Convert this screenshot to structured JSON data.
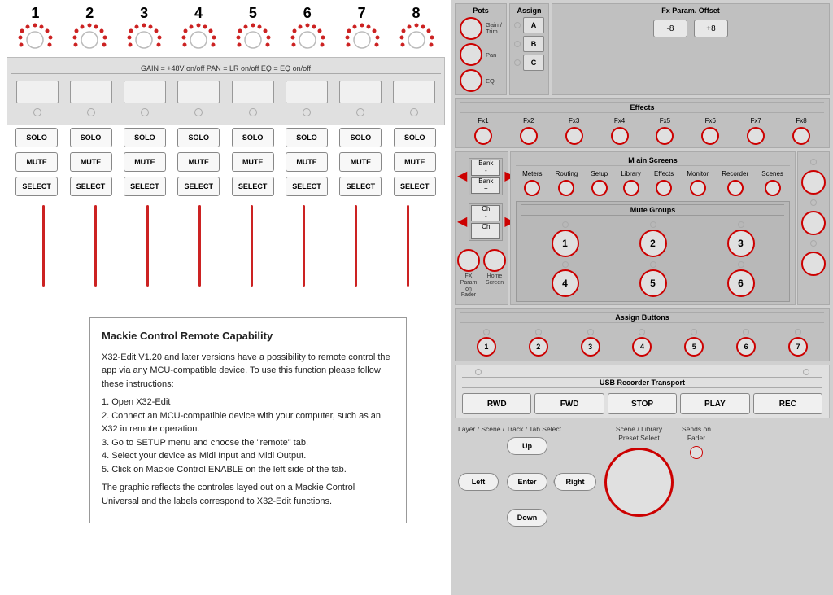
{
  "knobs": {
    "numbers": [
      "1",
      "2",
      "3",
      "4",
      "5",
      "6",
      "7",
      "8"
    ]
  },
  "channel": {
    "gain_bar": "GAIN = +48V on/off   PAN = LR on/off   EQ = EQ on/off",
    "buttons": {
      "solo": [
        "SOLO",
        "SOLO",
        "SOLO",
        "SOLO",
        "SOLO",
        "SOLO",
        "SOLO",
        "SOLO"
      ],
      "mute": [
        "MUTE",
        "MUTE",
        "MUTE",
        "MUTE",
        "MUTE",
        "MUTE",
        "MUTE",
        "MUTE"
      ],
      "select": [
        "SELECT",
        "SELECT",
        "SELECT",
        "SELECT",
        "SELECT",
        "SELECT",
        "SELECT",
        "SELECT"
      ]
    }
  },
  "info_box": {
    "title": "Mackie Control Remote Capability",
    "paragraphs": [
      "X32-Edit V1.20 and later versions have a possibility to remote control the app via any MCU-compatible device. To use this function please follow these instructions:",
      "1. Open X32-Edit\n2. Connect an MCU-compatible device with your computer, such as an X32 in remote operation.\n3. Go to SETUP menu and choose the \"remote\" tab.\n4. Select your device as Midi Input and Midi Output.\n5. Click on Mackie Control ENABLE on the left side of the tab.",
      "The graphic reflects the controles layed out on a Mackie Control Universal and the labels correspond to X32-Edit functions."
    ]
  },
  "right_panel": {
    "pots": {
      "title": "Pots",
      "items": [
        {
          "label": "Gain /\nTrim"
        },
        {
          "label": "Pan"
        },
        {
          "label": "EQ"
        }
      ]
    },
    "assign": {
      "title": "Assign",
      "buttons": [
        "A",
        "B",
        "C"
      ]
    },
    "fx_offset": {
      "title": "Fx Param. Offset",
      "buttons": [
        "-8",
        "+8"
      ]
    },
    "effects": {
      "title": "Effects",
      "items": [
        "Fx1",
        "Fx2",
        "Fx3",
        "Fx4",
        "Fx5",
        "Fx6",
        "Fx7",
        "Fx8"
      ]
    },
    "main_screens": {
      "title": "M ain Screens",
      "items": [
        "Meters",
        "Routing",
        "Setup",
        "Library",
        "Effects",
        "Monitor",
        "Recorder",
        "Scenes"
      ]
    },
    "bank": {
      "minus_label": "Bank\n-",
      "plus_label": "Bank\n+"
    },
    "ch": {
      "minus_label": "Ch\n-",
      "plus_label": "Ch\n+"
    },
    "fx_param_fader": {
      "label": "FX Param\non Fader"
    },
    "home_screen": {
      "label": "Home\nScreen"
    },
    "mute_groups": {
      "title": "Mute Groups",
      "buttons": [
        "1",
        "2",
        "3",
        "4",
        "5",
        "6"
      ]
    },
    "assign_buttons": {
      "title": "Assign Buttons",
      "buttons": [
        "1",
        "2",
        "3",
        "4",
        "5",
        "6",
        "7"
      ]
    },
    "usb_transport": {
      "title": "USB Recorder Transport",
      "buttons": [
        "RWD",
        "FWD",
        "STOP",
        "PLAY",
        "REC"
      ]
    },
    "nav": {
      "layer_title": "Layer / Scene / Track / Tab Select",
      "scene_library_title": "Scene / Library\nPreset Select",
      "sends_fader_title": "Sends on\nFader",
      "up": "Up",
      "down": "Down",
      "left": "Left",
      "right": "Right",
      "enter": "Enter"
    }
  }
}
